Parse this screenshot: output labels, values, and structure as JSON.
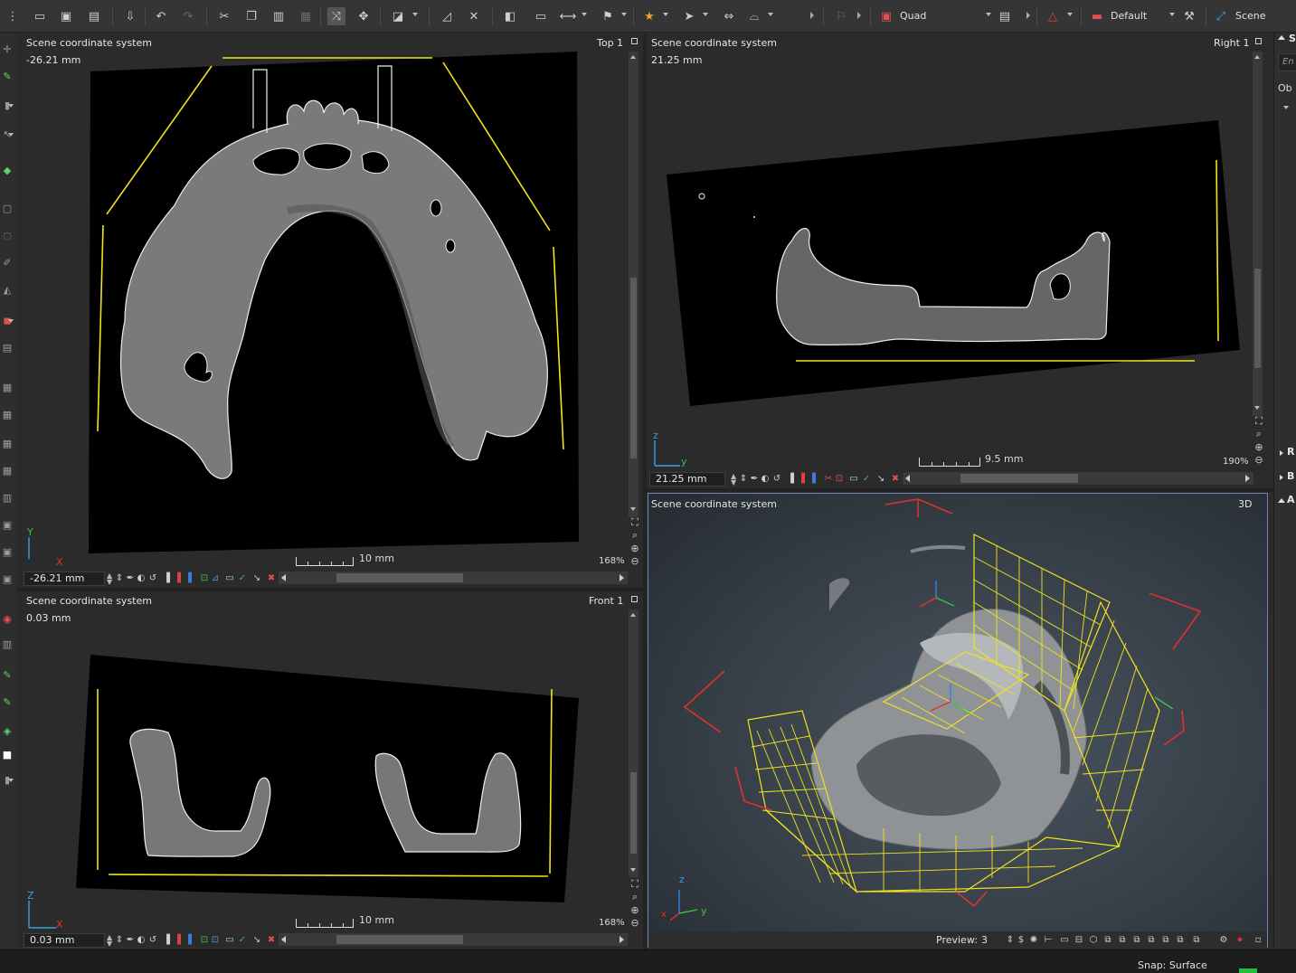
{
  "toolbar": {
    "layout_label": "Quad",
    "style_label": "Default",
    "scene_label": "Scene"
  },
  "viewports": {
    "top": {
      "coord_system": "Scene coordinate system",
      "name": "Top 1",
      "coordinate": "-26.21 mm",
      "scale_label": "10 mm",
      "zoom": "168%",
      "field_value": "-26.21 mm",
      "axis_h": "X",
      "axis_v": "Y"
    },
    "right": {
      "coord_system": "Scene coordinate system",
      "name": "Right 1",
      "coordinate": "21.25 mm",
      "scale_label": "9.5 mm",
      "zoom": "190%",
      "field_value": "21.25 mm",
      "axis_h": "y",
      "axis_v": "z"
    },
    "front": {
      "coord_system": "Scene coordinate system",
      "name": "Front 1",
      "coordinate": "0.03 mm",
      "scale_label": "10 mm",
      "zoom": "168%",
      "field_value": "0.03 mm",
      "axis_h": "X",
      "axis_v": "Z"
    },
    "three_d": {
      "coord_system": "Scene coordinate system",
      "name": "3D",
      "preview_label": "Preview:",
      "preview_value": "3",
      "axis_z": "z",
      "axis_y": "y",
      "axis_x": "x"
    }
  },
  "right_panel": {
    "tab_s": "S",
    "field_placeholder": "En",
    "obj_label": "Ob",
    "item_r": "R",
    "item_b": "B",
    "item_a": "A"
  },
  "status": {
    "snap": "Snap: Surface"
  },
  "colors": {
    "outline_yellow": "#f2e21e",
    "accent_blue": "#6d86b3",
    "axis_green": "#3cc04a",
    "axis_red": "#e03030",
    "axis_blue": "#3a7fe0",
    "status_green": "#1fbf3a"
  }
}
